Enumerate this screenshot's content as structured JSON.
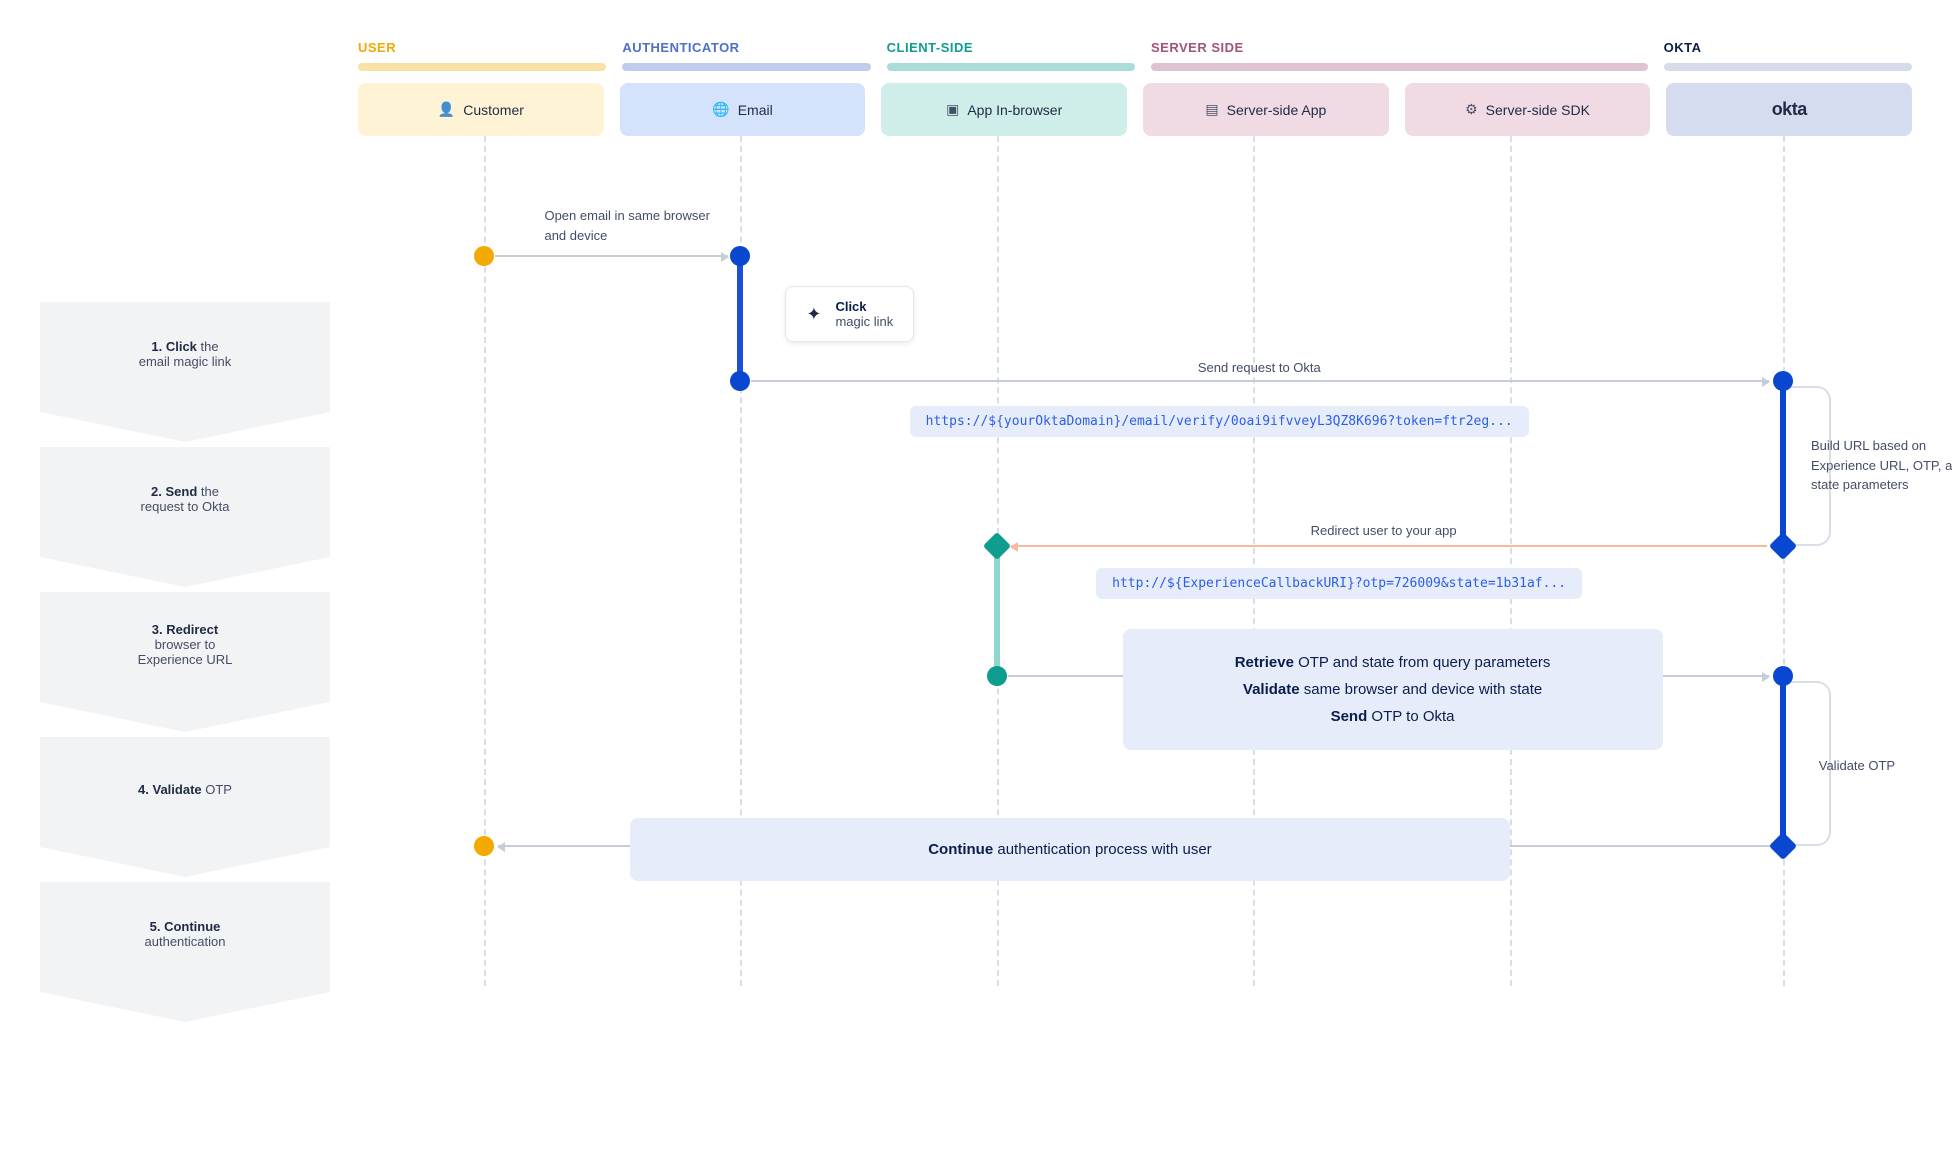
{
  "lanes": {
    "user": {
      "title": "USER",
      "actor": "Customer"
    },
    "auth": {
      "title": "AUTHENTICATOR",
      "actor": "Email"
    },
    "client": {
      "title": "CLIENT-SIDE",
      "actor": "App In-browser"
    },
    "server": {
      "title": "SERVER SIDE",
      "actor1": "Server-side App",
      "actor2": "Server-side SDK"
    },
    "okta": {
      "title": "OKTA",
      "actor": "okta"
    }
  },
  "steps": {
    "s1": {
      "b": "1. Click",
      "rest": " the",
      "line2": "email magic link"
    },
    "s2": {
      "b": "2. Send",
      "rest": " the",
      "line2": "request to Okta"
    },
    "s3": {
      "b": "3. Redirect",
      "line2": "browser to",
      "line3": "Experience URL"
    },
    "s4": {
      "b": "4. Validate",
      "rest": " OTP"
    },
    "s5": {
      "b": "5. Continue",
      "line2": "authentication"
    }
  },
  "labels": {
    "open_email": "Open email in same browser and device",
    "click_magic_b": "Click",
    "click_magic": "magic link",
    "send_request": "Send request to Okta",
    "url1": "https://${yourOktaDomain}/email/verify/0oai9ifvveyL3QZ8K696?token=ftr2eg...",
    "build_url": "Build URL  based on Experience URL, OTP, and state parameters",
    "redirect": "Redirect user to your app",
    "url2": "http://${ExperienceCallbackURI}?otp=726009&state=1b31af...",
    "retrieve_b": "Retrieve",
    "retrieve": " OTP and state from query parameters",
    "validate_b": "Validate",
    "validate": " same browser and device with state",
    "send_b": "Send",
    "send": " OTP to Okta",
    "validate_otp": "Validate OTP",
    "continue_b": "Continue",
    "continue": " authentication process with user"
  }
}
